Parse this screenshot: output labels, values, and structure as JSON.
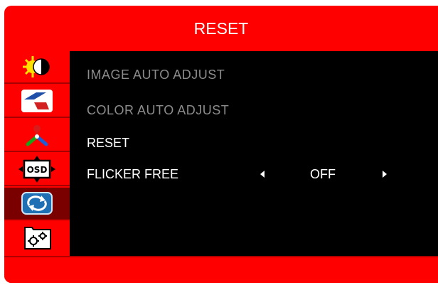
{
  "menu": {
    "title": "RESET",
    "items": [
      {
        "label": "IMAGE  AUTO  ADJUST",
        "state": "disabled"
      },
      {
        "label": "COLOR  AUTO  ADJUST",
        "state": "disabled"
      },
      {
        "label": "RESET",
        "state": "enabled"
      },
      {
        "label": "FLICKER FREE",
        "state": "enabled",
        "value": "OFF"
      }
    ]
  },
  "sidebar": {
    "items": [
      {
        "icon": "brightness-contrast-icon"
      },
      {
        "icon": "image-settings-icon"
      },
      {
        "icon": "color-settings-icon"
      },
      {
        "icon": "osd-icon",
        "text": "OSD"
      },
      {
        "icon": "reset-icon",
        "active": true
      },
      {
        "icon": "gear-icon"
      }
    ]
  },
  "colors": {
    "accent": "#ff0000",
    "active_item": "#7a0000",
    "panel": "#000000",
    "disabled_text": "#8c8c8c",
    "text": "#ffffff"
  }
}
